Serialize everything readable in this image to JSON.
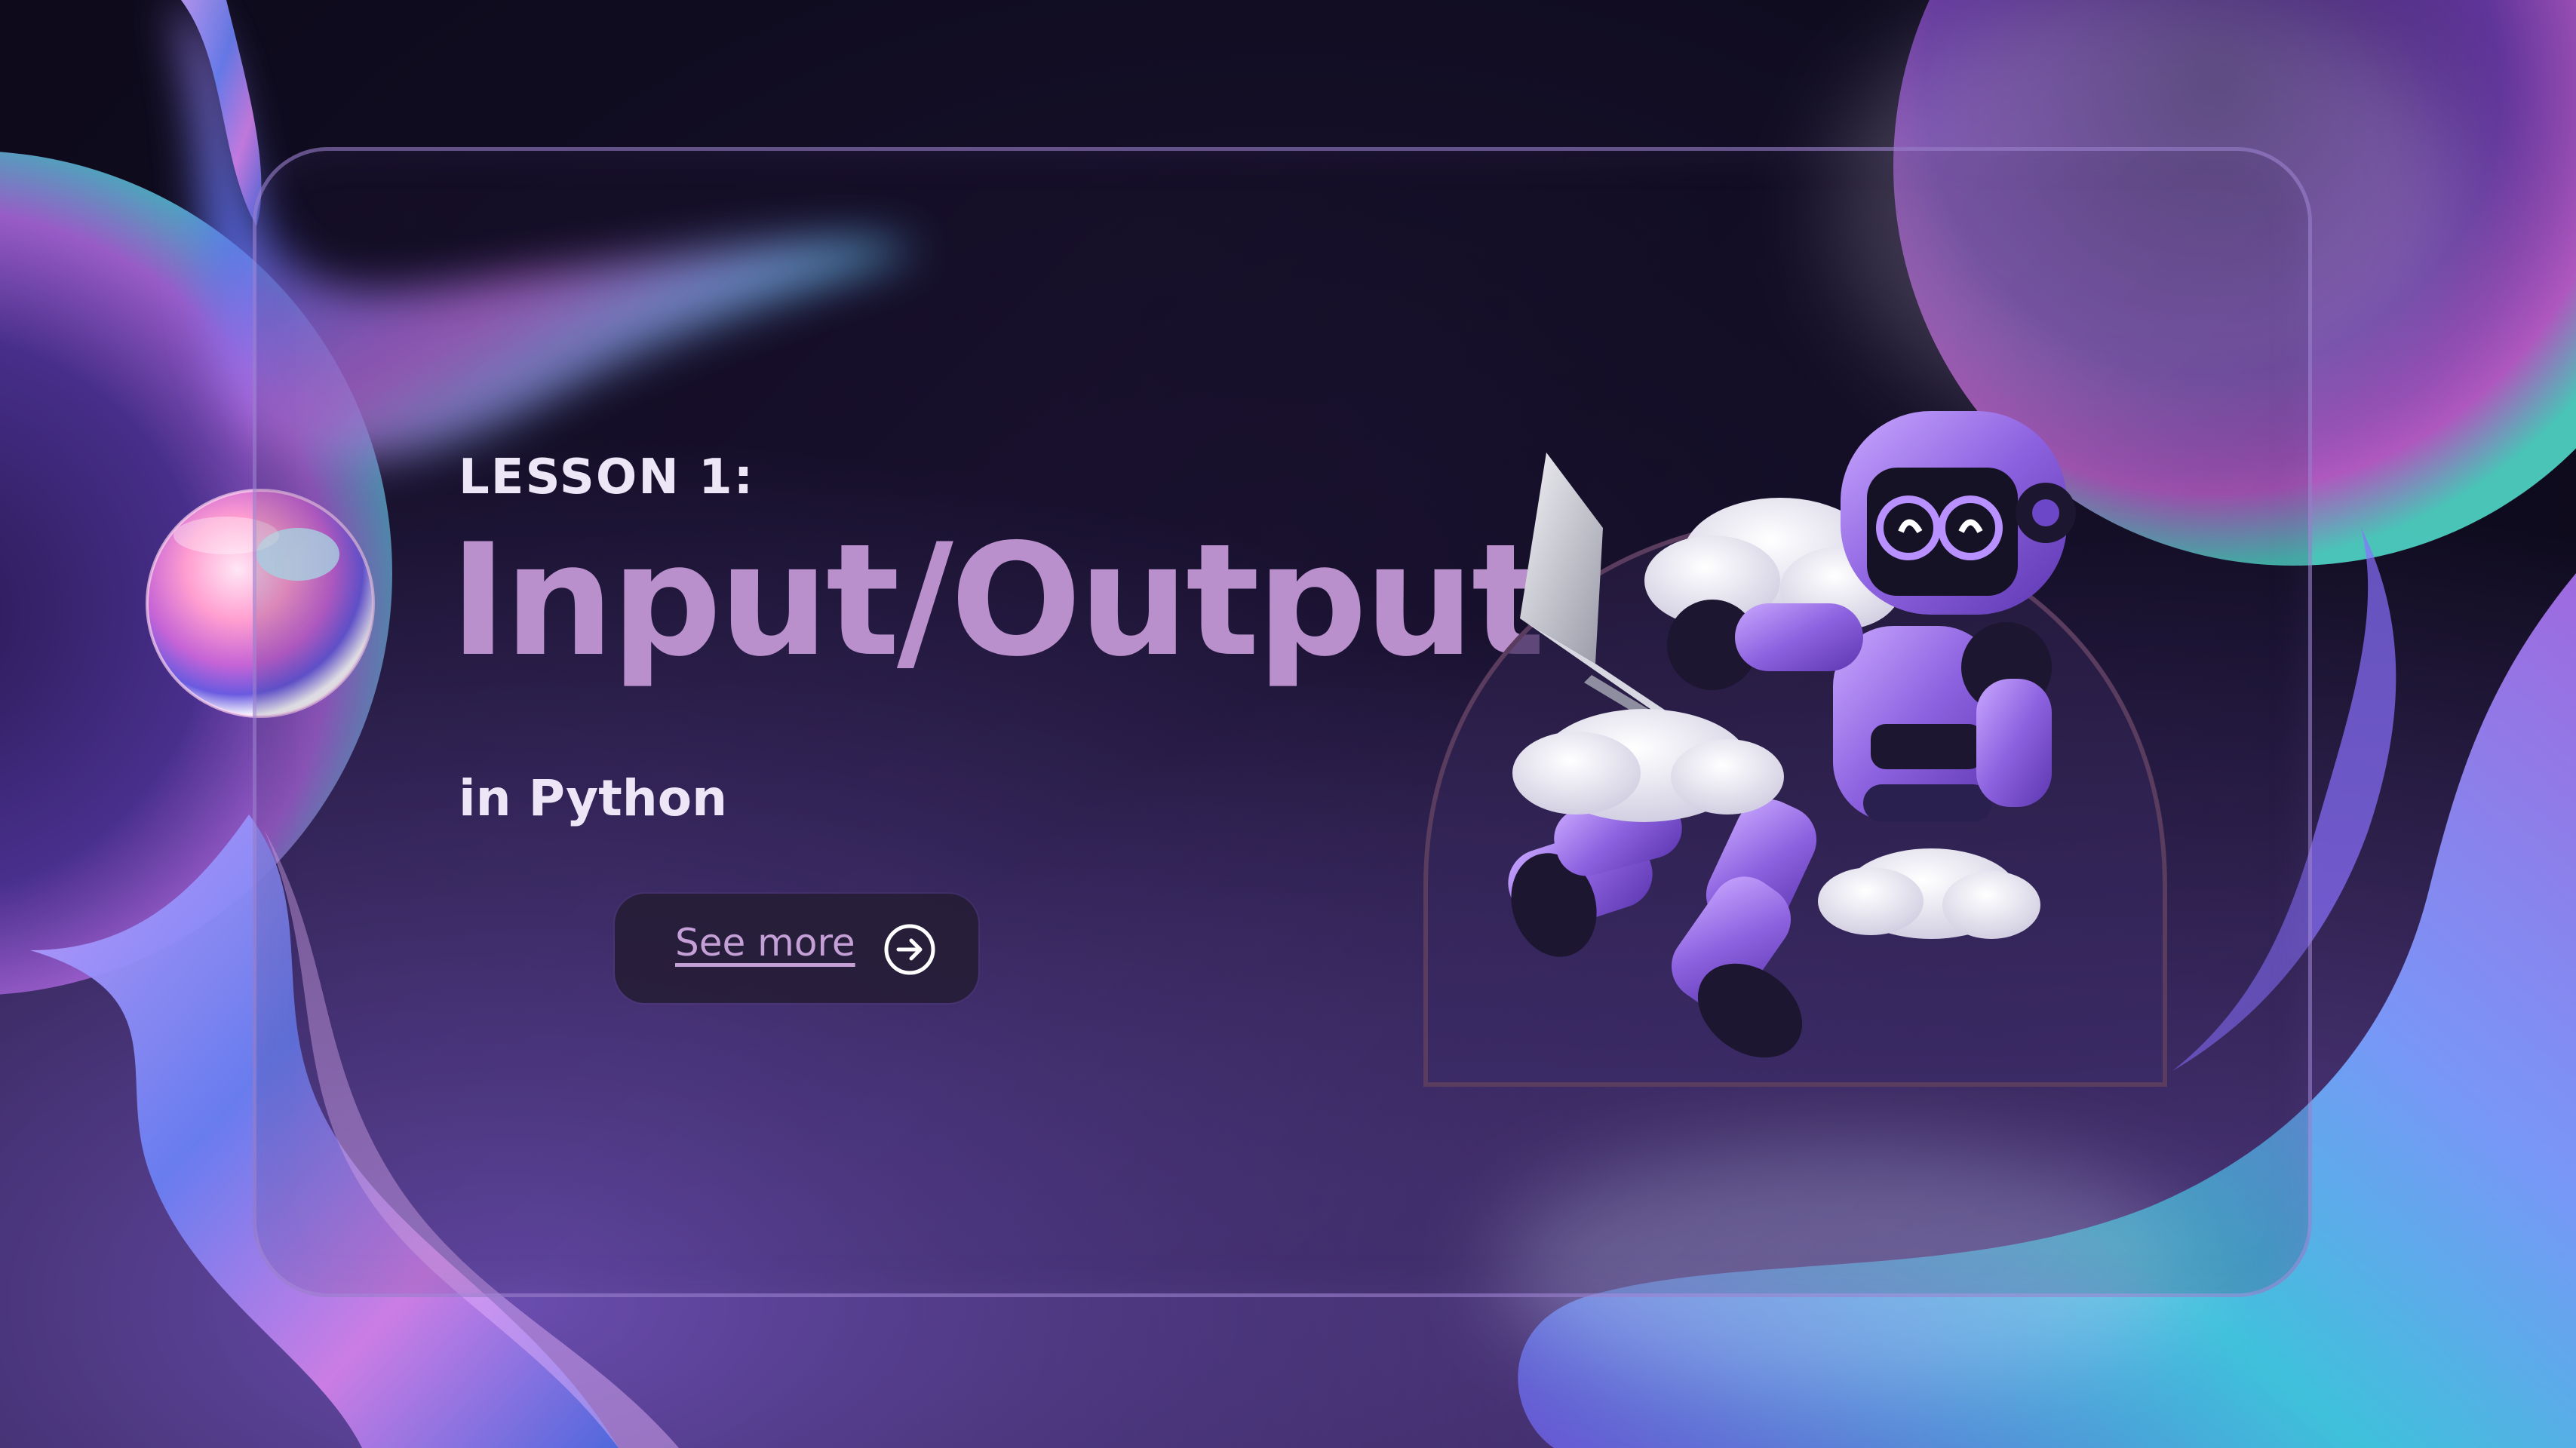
{
  "slide": {
    "eyebrow": "LESSON 1:",
    "title": "Input/Output",
    "subtitle": "in Python",
    "cta_label": "See more",
    "cta_icon": "arrow-right-circle-icon"
  },
  "colors": {
    "background": "#100c20",
    "title": "#b98fcc",
    "text": "#ece6f7",
    "cta_text": "#c4a0d6",
    "card_border": "#a88cdc",
    "robot_body": "#8d62e0",
    "ribbon": "#6f78e6"
  },
  "illustration": {
    "robot": "robot-with-laptop-illustration",
    "clouds": "cloud-icon"
  }
}
